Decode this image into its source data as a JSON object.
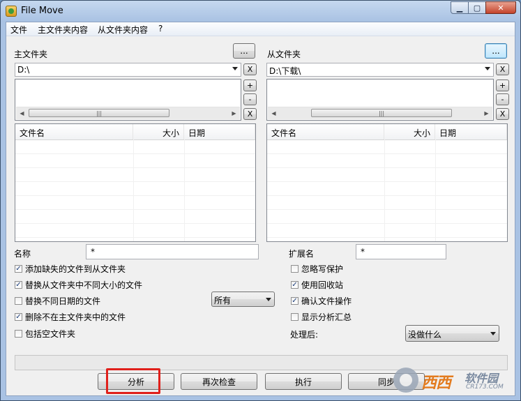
{
  "window": {
    "title": "File Move"
  },
  "menu": [
    "文件",
    "主文件夹内容",
    "从文件夹内容",
    "?"
  ],
  "master": {
    "label": "主文件夹",
    "browse_label": "...",
    "path": "D:\\",
    "x_label": "X",
    "plus_label": "+",
    "minus_label": "-",
    "scroll_grip": "|||",
    "columns": [
      "文件名",
      "大小",
      "日期"
    ]
  },
  "slave": {
    "label": "从文件夹",
    "browse_label": "...",
    "path": "D:\\下载\\",
    "x_label": "X",
    "plus_label": "+",
    "minus_label": "-",
    "scroll_grip": "|||",
    "columns": [
      "文件名",
      "大小",
      "日期"
    ]
  },
  "filters": {
    "name_label": "名称",
    "name_value": "*",
    "ext_label": "扩展名",
    "ext_value": "*"
  },
  "options_left": [
    {
      "label": "添加缺失的文件到从文件夹",
      "checked": true
    },
    {
      "label": "替换从文件夹中不同大小的文件",
      "checked": true
    },
    {
      "label": "替换不同日期的文件",
      "checked": false
    },
    {
      "label": "删除不在主文件夹中的文件",
      "checked": true
    },
    {
      "label": "包括空文件夹",
      "checked": false
    }
  ],
  "date_filter": {
    "selected": "所有"
  },
  "options_right": [
    {
      "label": "忽略写保护",
      "checked": false
    },
    {
      "label": "使用回收站",
      "checked": true
    },
    {
      "label": "确认文件操作",
      "checked": true
    },
    {
      "label": "显示分析汇总",
      "checked": false
    }
  ],
  "after": {
    "label": "处理后:",
    "selected": "没做什么"
  },
  "buttons": {
    "analyze": "分析",
    "recheck": "再次检查",
    "execute": "执行",
    "sync": "同步"
  },
  "watermark": {
    "brand": "西西",
    "name": "软件园",
    "url": "CR173.COM"
  },
  "icons": {
    "minimize": "minimize-icon",
    "maximize": "maximize-icon",
    "close": "close-icon",
    "scroll_left": "arrow-left-icon",
    "scroll_right": "arrow-right-icon",
    "dropdown": "chevron-down-icon"
  },
  "colors": {
    "highlight": "#e0201b",
    "watermark_orange": "#e37b1e"
  }
}
